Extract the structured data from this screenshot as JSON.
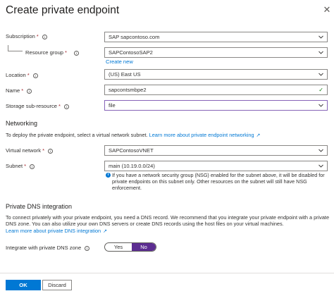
{
  "header": {
    "title": "Create private endpoint",
    "close_icon": "close-icon"
  },
  "form": {
    "subscription": {
      "label": "Subscription",
      "value": "SAP sapcontoso.com"
    },
    "resource_group": {
      "label": "Resource group",
      "value": "SAPContosoSAP2",
      "create_new": "Create new"
    },
    "location": {
      "label": "Location",
      "value": "(US) East US"
    },
    "name": {
      "label": "Name",
      "value": "sapcontsmbpe2"
    },
    "storage_sub_resource": {
      "label": "Storage sub-resource",
      "value": "file"
    }
  },
  "networking": {
    "heading": "Networking",
    "intro": "To deploy the private endpoint, select a virtual network subnet.",
    "learn_more": "Learn more about private endpoint networking",
    "virtual_network": {
      "label": "Virtual network",
      "value": "SAPContosoVNET"
    },
    "subnet": {
      "label": "Subnet",
      "value": "main (10.19.0.0/24)"
    },
    "subnet_note": "If you have a network security group (NSG) enabled for the subnet above, it will be disabled for private endpoints on this subnet only. Other resources on the subnet will still have NSG enforcement."
  },
  "dns": {
    "heading": "Private DNS integration",
    "intro": "To connect privately with your private endpoint, you need a DNS record. We recommend that you integrate your private endpoint with a private DNS zone. You can also utilize your own DNS servers or create DNS records using the host files on your virtual machines.",
    "learn_more": "Learn more about private DNS integration",
    "integrate": {
      "label": "Integrate with private DNS zone",
      "yes": "Yes",
      "no": "No",
      "selected": "No"
    }
  },
  "footer": {
    "ok": "OK",
    "discard": "Discard"
  },
  "colors": {
    "accent": "#0078d4",
    "toggle_selected": "#5c2d91",
    "required": "#a4262c",
    "active_border": "#8764b8"
  }
}
